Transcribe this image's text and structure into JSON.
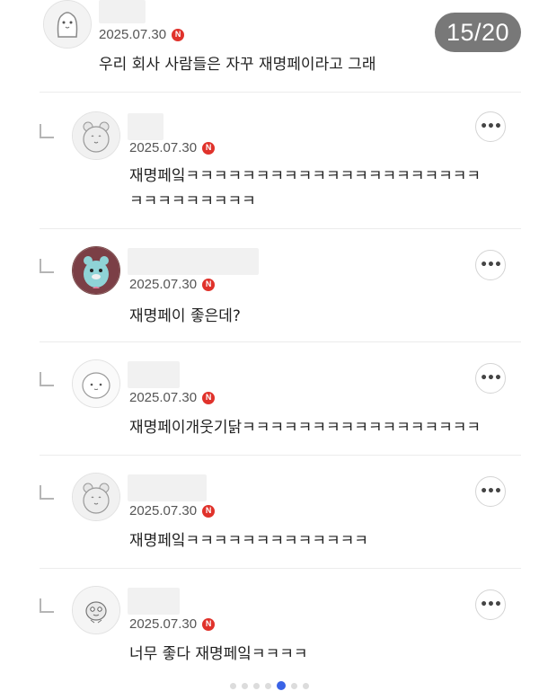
{
  "page_counter": "15/20",
  "comments": [
    {
      "date": "2025.07.30",
      "badge": "N",
      "text": "우리 회사 사람들은 자꾸 재명페이라고 그래",
      "avatar_icon": "ghost-character-icon",
      "is_reply": false
    },
    {
      "date": "2025.07.30",
      "badge": "N",
      "text": "재명페잌ㅋㅋㅋㅋㅋㅋㅋㅋㅋㅋㅋㅋㅋㅋㅋㅋㅋㅋㅋㅋㅋㅋㅋㅋㅋㅋㅋㅋㅋㅋ",
      "avatar_icon": "bear-character-icon",
      "is_reply": true
    },
    {
      "date": "2025.07.30",
      "badge": "N",
      "text": "재명페이 좋은데?",
      "avatar_icon": "blue-beaver-icon",
      "is_reply": true
    },
    {
      "date": "2025.07.30",
      "badge": "N",
      "text": "재명페이개웃기닭ㅋㅋㅋㅋㅋㅋㅋㅋㅋㅋㅋㅋㅋㅋㅋㅋㅋ",
      "avatar_icon": "round-face-icon",
      "is_reply": true
    },
    {
      "date": "2025.07.30",
      "badge": "N",
      "text": "재명페잌ㅋㅋㅋㅋㅋㅋㅋㅋㅋㅋㅋㅋㅋ",
      "avatar_icon": "bear-character-icon",
      "is_reply": true
    },
    {
      "date": "2025.07.30",
      "badge": "N",
      "text": "너무 좋다 재명페잌ㅋㅋㅋㅋ",
      "avatar_icon": "small-creature-icon",
      "is_reply": true
    }
  ],
  "more_button_label": "•••",
  "pagination": {
    "total_dots": 7,
    "active_index": 4
  },
  "colors": {
    "badge": "#e0322b",
    "active_dot": "#3a63e6",
    "counter_bg": "#5a5a5a"
  }
}
